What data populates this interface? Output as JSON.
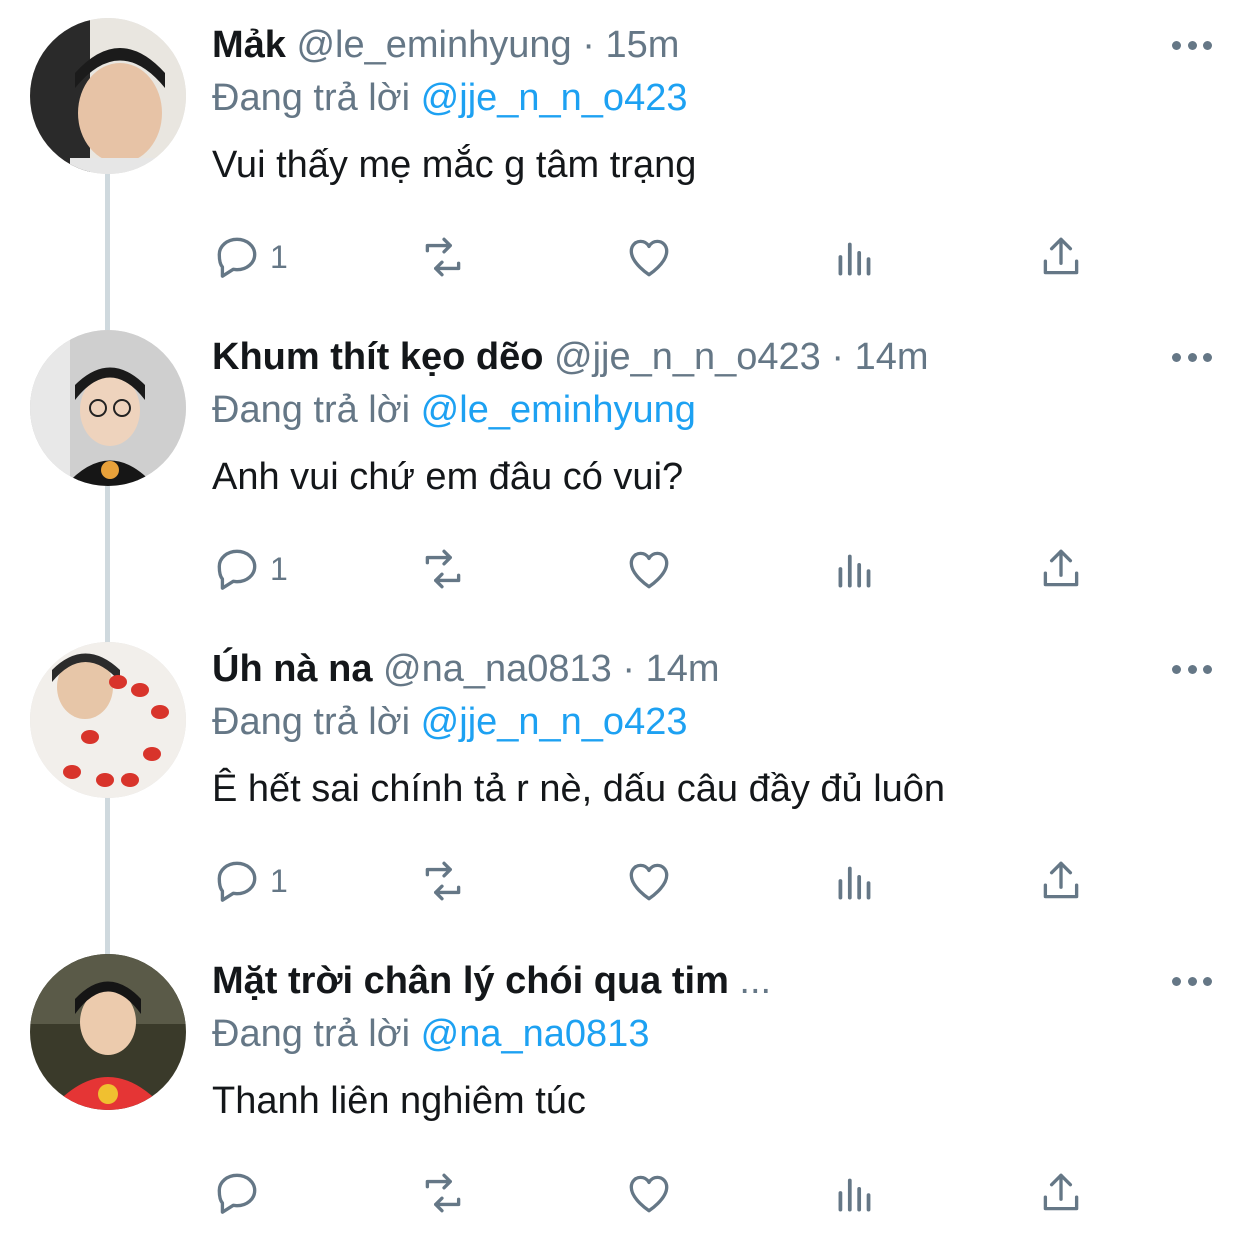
{
  "colors": {
    "accent": "#1da1f2",
    "muted": "#657786",
    "text": "#14171a",
    "thread_line": "#cfd9de"
  },
  "tweets": [
    {
      "name": "Mảk",
      "handle": "@le_eminhyung",
      "sep": "·",
      "time": "15m",
      "reply_prefix": "Đang trả lời",
      "reply_to": "@jje_n_n_o423",
      "text": "Vui thấy mẹ mắc g tâm trạng",
      "reply_count": "1",
      "avatar": "avatar-photo-boy-smiling"
    },
    {
      "name": "Khum thít kẹo dẽo",
      "handle": "@jje_n_n_o423",
      "sep": "·",
      "time": "14m",
      "reply_prefix": "Đang trả lời",
      "reply_to": "@le_eminhyung",
      "text": "Anh vui chứ em đâu có vui?",
      "reply_count": "1",
      "avatar": "avatar-photo-boy-glasses"
    },
    {
      "name": "Úh nà na",
      "handle": "@na_na0813",
      "sep": "·",
      "time": "14m",
      "reply_prefix": "Đang trả lời",
      "reply_to": "@jje_n_n_o423",
      "text": "Ê hết sai chính tả r nè, dấu câu đầy đủ luôn",
      "reply_count": "1",
      "avatar": "avatar-photo-strawberries"
    },
    {
      "name": "Mặt trời chân lý chói qua tim",
      "handle": "...",
      "sep": "",
      "time": "",
      "reply_prefix": "Đang trả lời",
      "reply_to": "@na_na0813",
      "text": "Thanh liên nghiêm túc",
      "reply_count": "",
      "avatar": "avatar-photo-boy-red-hoodie"
    }
  ]
}
